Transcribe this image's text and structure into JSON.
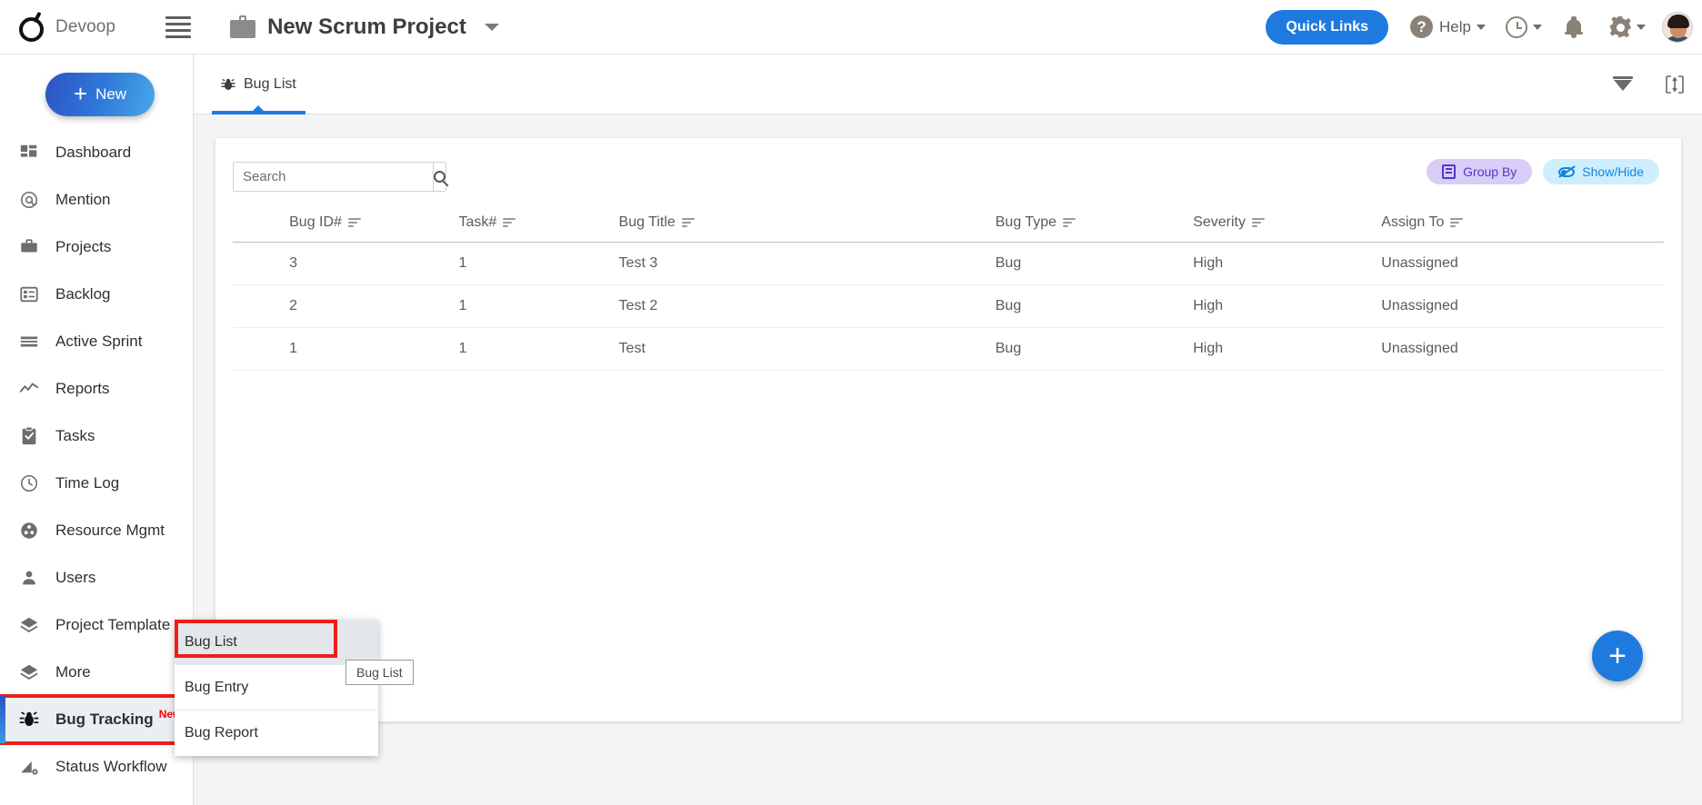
{
  "header": {
    "brand_name": "Devoop",
    "brand_logo_icon": "devoop-logo-icon",
    "menu_icon": "hamburger-icon",
    "project_icon": "briefcase-icon",
    "project_title": "New Scrum Project",
    "project_caret_icon": "chevron-down-icon",
    "quick_links_label": "Quick Links",
    "help_label": "Help",
    "help_icon": "question-circle-icon",
    "clock_icon": "clock-icon",
    "bell_icon": "bell-icon",
    "gear_icon": "gear-icon",
    "avatar_icon": "avatar"
  },
  "sidebar": {
    "new_button_label": "New",
    "new_button_icon": "plus-icon",
    "items": [
      {
        "label": "Dashboard",
        "icon": "dashboard-icon",
        "active": false
      },
      {
        "label": "Mention",
        "icon": "at-icon",
        "active": false
      },
      {
        "label": "Projects",
        "icon": "briefcase-icon",
        "active": false
      },
      {
        "label": "Backlog",
        "icon": "backlog-icon",
        "active": false
      },
      {
        "label": "Active Sprint",
        "icon": "sprint-icon",
        "active": false
      },
      {
        "label": "Reports",
        "icon": "chart-line-icon",
        "active": false
      },
      {
        "label": "Tasks",
        "icon": "clipboard-check-icon",
        "active": false
      },
      {
        "label": "Time Log",
        "icon": "clock-icon",
        "active": false
      },
      {
        "label": "Resource Mgmt",
        "icon": "people-icon",
        "active": false
      },
      {
        "label": "Users",
        "icon": "user-icon",
        "active": false
      },
      {
        "label": "Project Template",
        "icon": "layers-icon",
        "active": false
      },
      {
        "label": "More",
        "icon": "layers-icon",
        "active": false
      },
      {
        "label": "Bug Tracking",
        "icon": "bug-icon",
        "active": true,
        "badge": "New",
        "highlighted": true
      },
      {
        "label": "Status Workflow",
        "icon": "workflow-icon",
        "active": false
      }
    ]
  },
  "submenu": {
    "items": [
      {
        "label": "Bug List",
        "selected": true,
        "highlighted": true
      },
      {
        "label": "Bug Entry",
        "selected": false,
        "highlighted": false
      },
      {
        "label": "Bug Report",
        "selected": false,
        "highlighted": false
      }
    ],
    "tooltip": "Bug List"
  },
  "content": {
    "tabs": [
      {
        "label": "Bug List",
        "icon": "bug-icon",
        "active": true
      }
    ],
    "tabbar_right": [
      {
        "icon": "filter-funnel-icon"
      },
      {
        "icon": "expand-rows-icon"
      }
    ],
    "search": {
      "placeholder": "Search",
      "value": "",
      "button_icon": "search-icon"
    },
    "chips": [
      {
        "label": "Group By",
        "icon": "group-by-icon",
        "color": "#5436c7",
        "bg": "#d7cdf7"
      },
      {
        "label": "Show/Hide",
        "icon": "eye-slash-icon",
        "color": "#1184e0",
        "bg": "#cfeefd"
      }
    ],
    "table": {
      "columns": [
        {
          "label": "Bug ID#",
          "sort_icon": "sort-icon"
        },
        {
          "label": "Task#",
          "sort_icon": "sort-icon"
        },
        {
          "label": "Bug Title",
          "sort_icon": "sort-icon"
        },
        {
          "label": "Bug Type",
          "sort_icon": "sort-icon"
        },
        {
          "label": "Severity",
          "sort_icon": "sort-icon"
        },
        {
          "label": "Assign To",
          "sort_icon": "sort-icon"
        }
      ],
      "rows": [
        {
          "bug_id": "3",
          "task": "1",
          "title": "Test 3",
          "type": "Bug",
          "severity": "High",
          "assign_to": "Unassigned"
        },
        {
          "bug_id": "2",
          "task": "1",
          "title": "Test 2",
          "type": "Bug",
          "severity": "High",
          "assign_to": "Unassigned"
        },
        {
          "bug_id": "1",
          "task": "1",
          "title": "Test",
          "type": "Bug",
          "severity": "High",
          "assign_to": "Unassigned"
        }
      ]
    },
    "fab": {
      "icon": "plus-icon",
      "label": "+"
    }
  },
  "colors": {
    "accent_blue": "#1f7ae0",
    "link_blue": "#2266dd",
    "bug_red": "#ff0000",
    "highlight_red": "#ee1d1d",
    "group_by_purple": "#5436c7",
    "show_hide_blue": "#1184e0"
  }
}
